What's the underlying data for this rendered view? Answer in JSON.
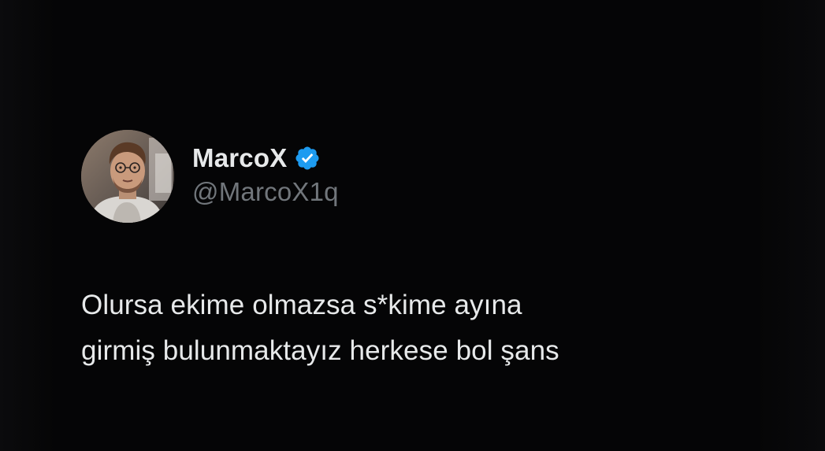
{
  "tweet": {
    "author": {
      "display_name": "MarcoX",
      "handle": "@MarcoX1q",
      "verified": true,
      "verified_icon": "verified-badge-icon",
      "avatar": "avatar-photo"
    },
    "text_lines": [
      "Olursa ekime olmazsa s*kime ayına",
      "girmiş bulunmaktayız herkese bol şans"
    ]
  },
  "colors": {
    "background": "#000000",
    "text_primary": "#e7e9ea",
    "text_secondary": "#71767b",
    "verified_blue": "#1d9bf0"
  }
}
